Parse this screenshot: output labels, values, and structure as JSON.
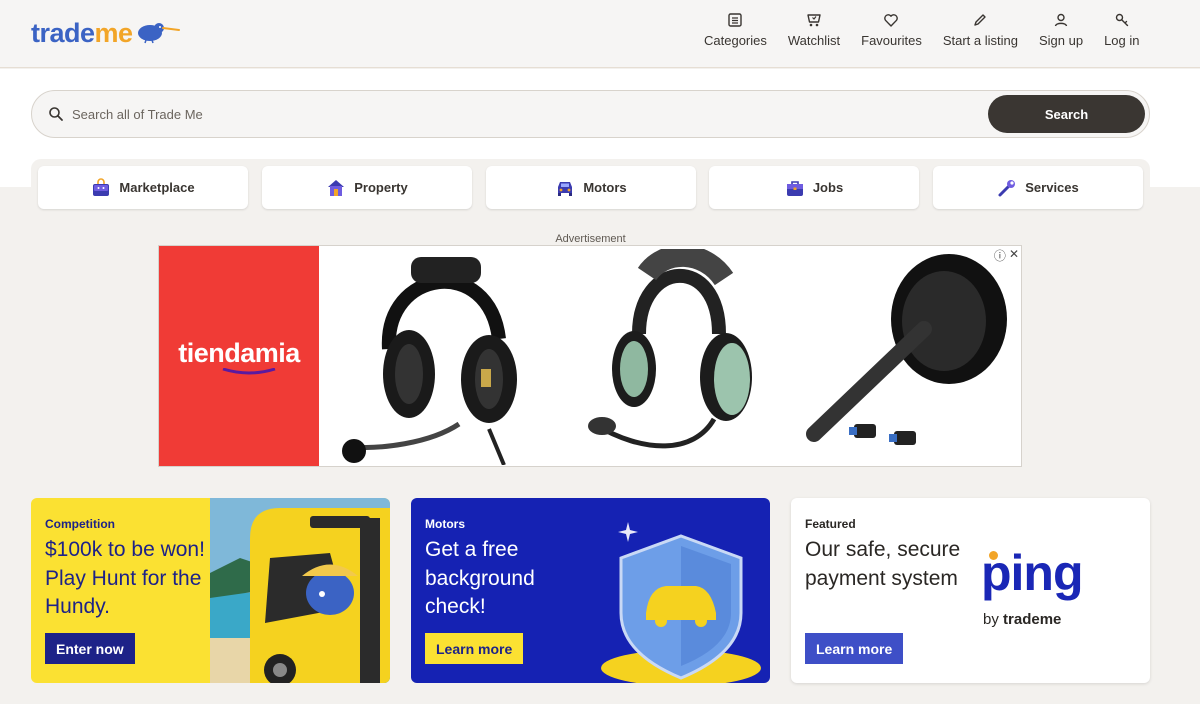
{
  "header": {
    "logo": {
      "part1": "trade",
      "part2": "me"
    },
    "nav": [
      {
        "icon": "categories-icon",
        "label": "Categories"
      },
      {
        "icon": "watchlist-icon",
        "label": "Watchlist"
      },
      {
        "icon": "heart-icon",
        "label": "Favourites"
      },
      {
        "icon": "pencil-icon",
        "label": "Start a listing"
      },
      {
        "icon": "user-icon",
        "label": "Sign up"
      },
      {
        "icon": "key-icon",
        "label": "Log in"
      }
    ]
  },
  "search": {
    "placeholder": "Search all of Trade Me",
    "button": "Search"
  },
  "categories": [
    {
      "icon": "marketplace-bag-icon",
      "label": "Marketplace"
    },
    {
      "icon": "house-icon",
      "label": "Property"
    },
    {
      "icon": "car-icon",
      "label": "Motors"
    },
    {
      "icon": "briefcase-icon",
      "label": "Jobs"
    },
    {
      "icon": "wrench-icon",
      "label": "Services"
    }
  ],
  "ad": {
    "label": "Advertisement",
    "brand": "tiendamia",
    "info_icon": "ⓘ",
    "close_icon": "✕"
  },
  "promos": [
    {
      "eyebrow": "Competition",
      "headline": "$100k to be won! Play Hunt for the Hundy.",
      "cta": "Enter now"
    },
    {
      "eyebrow": "Motors",
      "headline": "Get a free background check!",
      "cta": "Learn more"
    },
    {
      "eyebrow": "Featured",
      "headline": "Our safe, secure payment system",
      "cta": "Learn more",
      "logo_word": "ping",
      "logo_by": "by",
      "logo_brand": "trademe"
    }
  ],
  "colors": {
    "brand_blue": "#3b63c4",
    "brand_orange": "#f2a528",
    "competition_yellow": "#fbe132",
    "motors_blue": "#1522b3",
    "ad_red": "#f03b36"
  }
}
